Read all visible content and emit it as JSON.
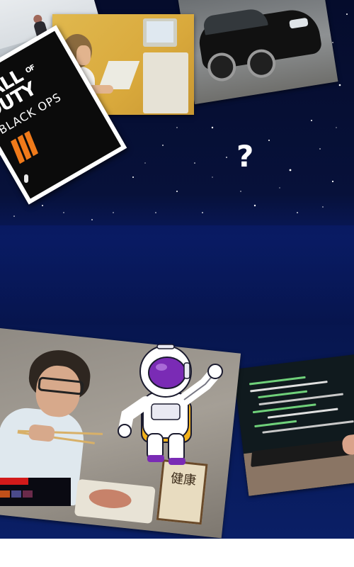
{
  "scene": {
    "background": "starry night sky collage",
    "accent_colors": {
      "sky_top": "#050c2c",
      "sky_bottom": "#0a1f66",
      "cod_orange": "#f07a1a",
      "visor_purple": "#7a2bb5"
    }
  },
  "cod_cover": {
    "title_line1": "CALL",
    "title_of": "OF",
    "title_line2": "DUTY",
    "subtitle": "BLACK OPS",
    "icon": "roman-numeral-iiii-icon"
  },
  "question_mark": "?",
  "sign_text": "健康"
}
